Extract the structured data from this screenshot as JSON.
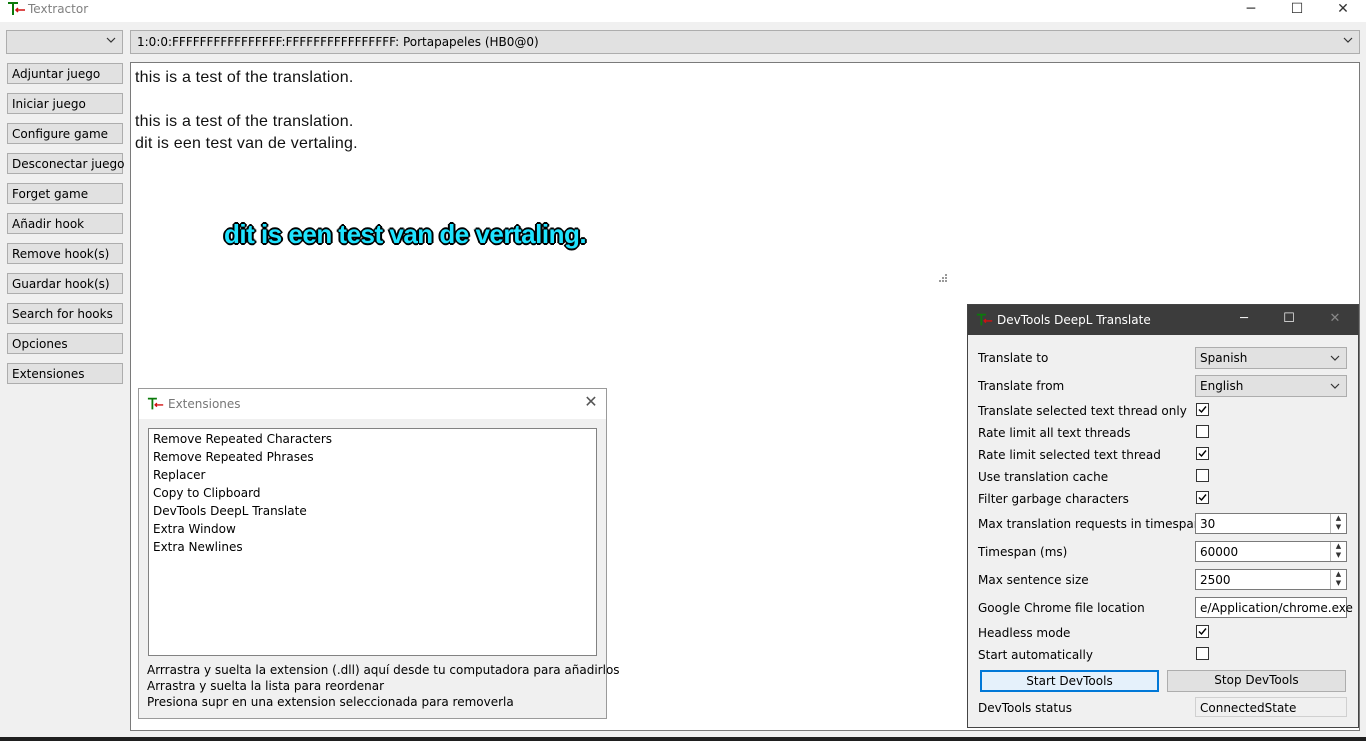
{
  "app": {
    "title": "Textractor",
    "thread_selector_value": "",
    "active_thread": "1:0:0:FFFFFFFFFFFFFFFF:FFFFFFFFFFFFFFFF: Portapapeles (HB0@0)"
  },
  "window_controls": {
    "minimize": "─",
    "maximize": "☐",
    "close": "✕"
  },
  "sidebar": {
    "buttons": [
      "Adjuntar juego",
      "Iniciar juego",
      "Configure game",
      "Desconectar juego",
      "Forget game",
      "Añadir hook",
      "Remove hook(s)",
      "Guardar hook(s)",
      "Search for hooks",
      "Opciones",
      "Extensiones"
    ]
  },
  "text_output": {
    "lines": [
      "this is a test of the translation.",
      "this is a test of the translation.",
      "dit is een test van de vertaling."
    ]
  },
  "overlay": {
    "text": "dit is een test van de vertaling.",
    "color": "#1fe3ff"
  },
  "extensions_dialog": {
    "title": "Extensiones",
    "items": [
      "Remove Repeated Characters",
      "Remove Repeated Phrases",
      "Replacer",
      "Copy to Clipboard",
      "DevTools DeepL Translate",
      "Extra Window",
      "Extra Newlines"
    ],
    "help": [
      "Arrrastra y suelta la extension (.dll) aquí desde tu computadora para añadirlos",
      "Arrastra y suelta la lista para reordenar",
      "Presiona supr en una extension seleccionada para removerla"
    ]
  },
  "deepl": {
    "title": "DevTools DeepL Translate",
    "translate_to": {
      "label": "Translate to",
      "value": "Spanish"
    },
    "translate_from": {
      "label": "Translate from",
      "value": "English"
    },
    "checkboxes": [
      {
        "label": "Translate selected text thread only",
        "checked": true
      },
      {
        "label": "Rate limit all text threads",
        "checked": false
      },
      {
        "label": "Rate limit selected text thread",
        "checked": true
      },
      {
        "label": "Use translation cache",
        "checked": false
      },
      {
        "label": "Filter garbage characters",
        "checked": true
      }
    ],
    "spinners": [
      {
        "label": "Max translation requests in timespan",
        "value": "30"
      },
      {
        "label": "Timespan (ms)",
        "value": "60000"
      },
      {
        "label": "Max sentence size",
        "value": "2500"
      }
    ],
    "chrome_location": {
      "label": "Google Chrome file location",
      "value": "e/Application/chrome.exe"
    },
    "checkboxes2": [
      {
        "label": "Headless mode",
        "checked": true
      },
      {
        "label": "Start automatically",
        "checked": false
      }
    ],
    "start_button": "Start DevTools",
    "stop_button": "Stop DevTools",
    "status": {
      "label": "DevTools status",
      "value": "ConnectedState"
    },
    "accent": "#0078d7"
  }
}
